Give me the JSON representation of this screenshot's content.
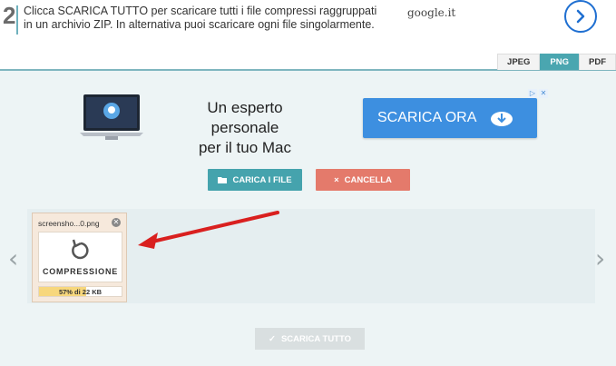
{
  "step": {
    "number": "2",
    "text": "Clicca SCARICA TUTTO per scaricare tutti i file compressi raggruppati in un archivio ZIP. In alternativa puoi scaricare ogni file singolarmente.",
    "source": "google.it"
  },
  "tabs": [
    {
      "label": "JPEG",
      "active": false
    },
    {
      "label": "PNG",
      "active": true
    },
    {
      "label": "PDF",
      "active": false
    }
  ],
  "ad": {
    "line1": "Un esperto personale",
    "line2": "per il tuo Mac",
    "cta": "SCARICA ORA"
  },
  "actions": {
    "upload": "CARICA I FILE",
    "cancel": "CANCELLA",
    "download_all": "SCARICA TUTTO"
  },
  "file": {
    "name": "screensho...0.png",
    "status": "COMPRESSIONE",
    "progress_label": "57% di 22 KB",
    "progress_fraction": 0.57
  },
  "colors": {
    "accent": "#45a3ad",
    "cancel": "#e47a6b",
    "ad_button": "#3d8fe0",
    "arrow": "#d9201f"
  }
}
